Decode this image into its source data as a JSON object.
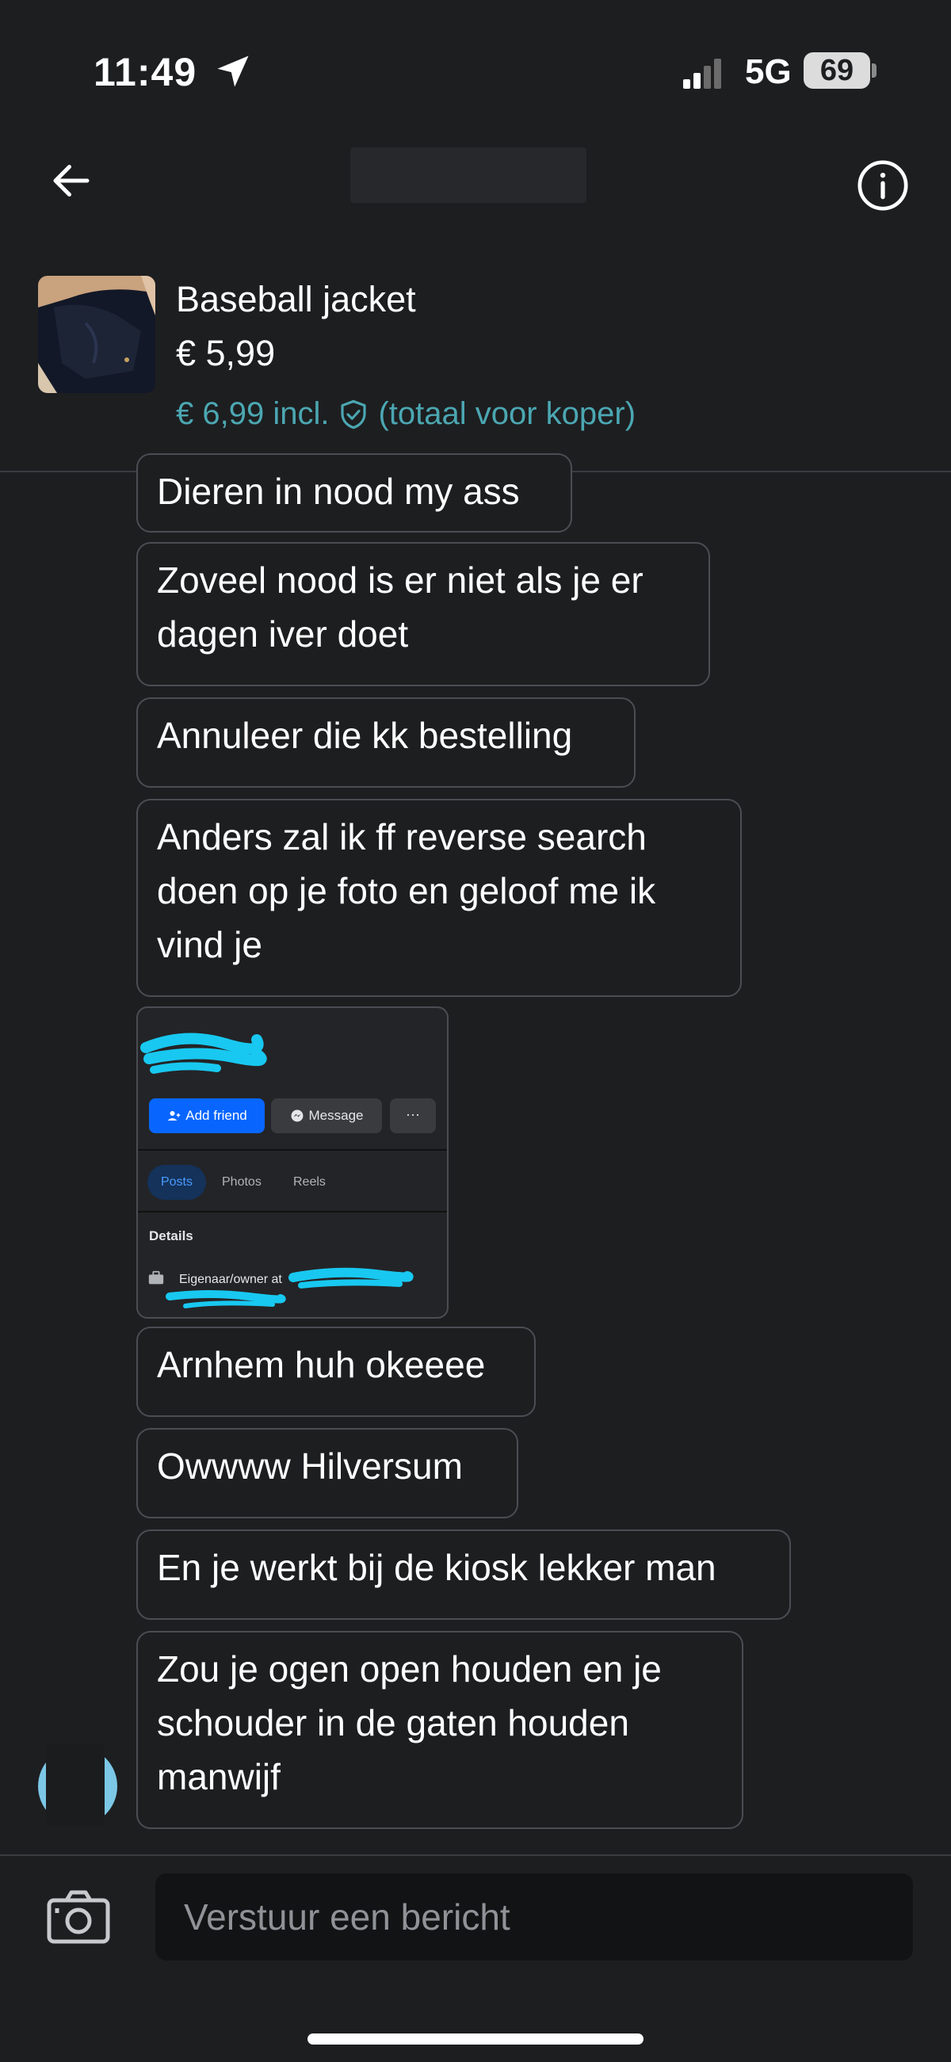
{
  "status_bar": {
    "time": "11:49",
    "network": "5G",
    "battery": "69"
  },
  "header": {
    "back_icon": "arrow-left-icon",
    "info_icon": "info-circle-icon"
  },
  "product": {
    "title": "Baseball jacket",
    "price": "€ 5,99",
    "price_incl": "€ 6,99 incl.",
    "price_incl_note": "(totaal voor koper)",
    "shield_icon": "shield-check-icon",
    "accent_color": "#4ba7b2"
  },
  "messages": [
    {
      "text": "Dieren in nood my ass"
    },
    {
      "text": "Zoveel nood is er niet als je er\ndagen iver doet"
    },
    {
      "text": "Annuleer die kk bestelling"
    },
    {
      "text": "Anders zal ik ff reverse search\ndoen op je foto en geloof me ik\nvind je"
    },
    {
      "type": "image",
      "screenshot": {
        "add_friend": "Add friend",
        "message": "Message",
        "more": "···",
        "tabs": [
          "Posts",
          "Photos",
          "Reels"
        ],
        "details": "Details",
        "owner_line": "Eigenaar/owner at"
      }
    },
    {
      "text": "Arnhem huh okeeee"
    },
    {
      "text": "Owwww Hilversum"
    },
    {
      "text": "En je werkt bij de kiosk lekker man"
    },
    {
      "text": "Zou je ogen open houden en je\nschouder in de gaten houden\nmanwijf"
    }
  ],
  "composer": {
    "placeholder": "Verstuur een bericht",
    "camera_icon": "camera-icon"
  }
}
